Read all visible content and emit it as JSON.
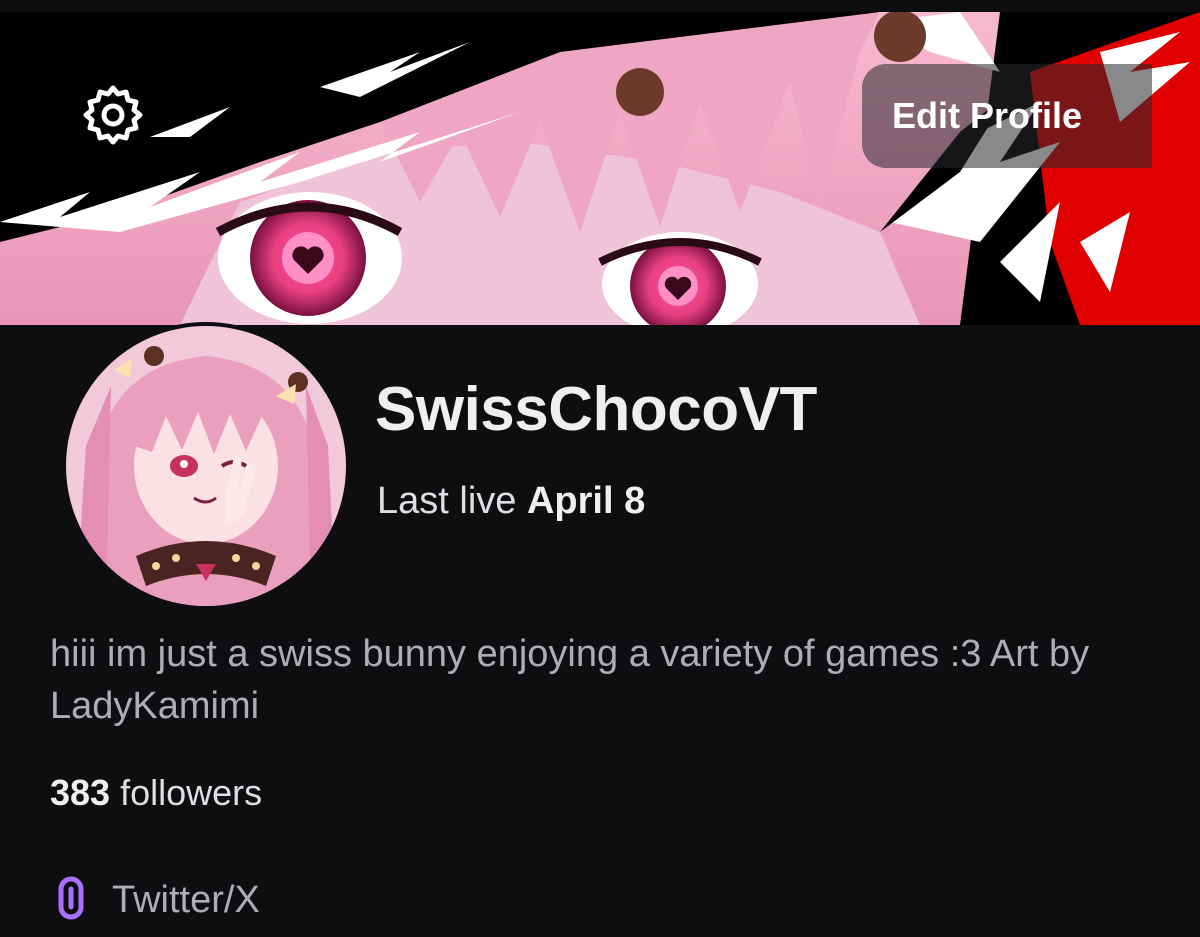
{
  "header": {
    "settings_icon": "gear-icon",
    "edit_profile_label": "Edit Profile"
  },
  "profile": {
    "username": "SwissChocoVT",
    "last_live_prefix": "Last live",
    "last_live_date": "April 8",
    "bio": "hiii im just a swiss bunny enjoying a variety of games :3 Art by LadyKamimi",
    "followers_count": "383",
    "followers_label": "followers"
  },
  "social_links": [
    {
      "icon": "link-icon",
      "label": "Twitter/X"
    }
  ],
  "colors": {
    "background": "#0e0e10",
    "accent_purple": "#a970ff",
    "banner_red": "#e00000",
    "banner_pink": "#f3a9c6"
  }
}
